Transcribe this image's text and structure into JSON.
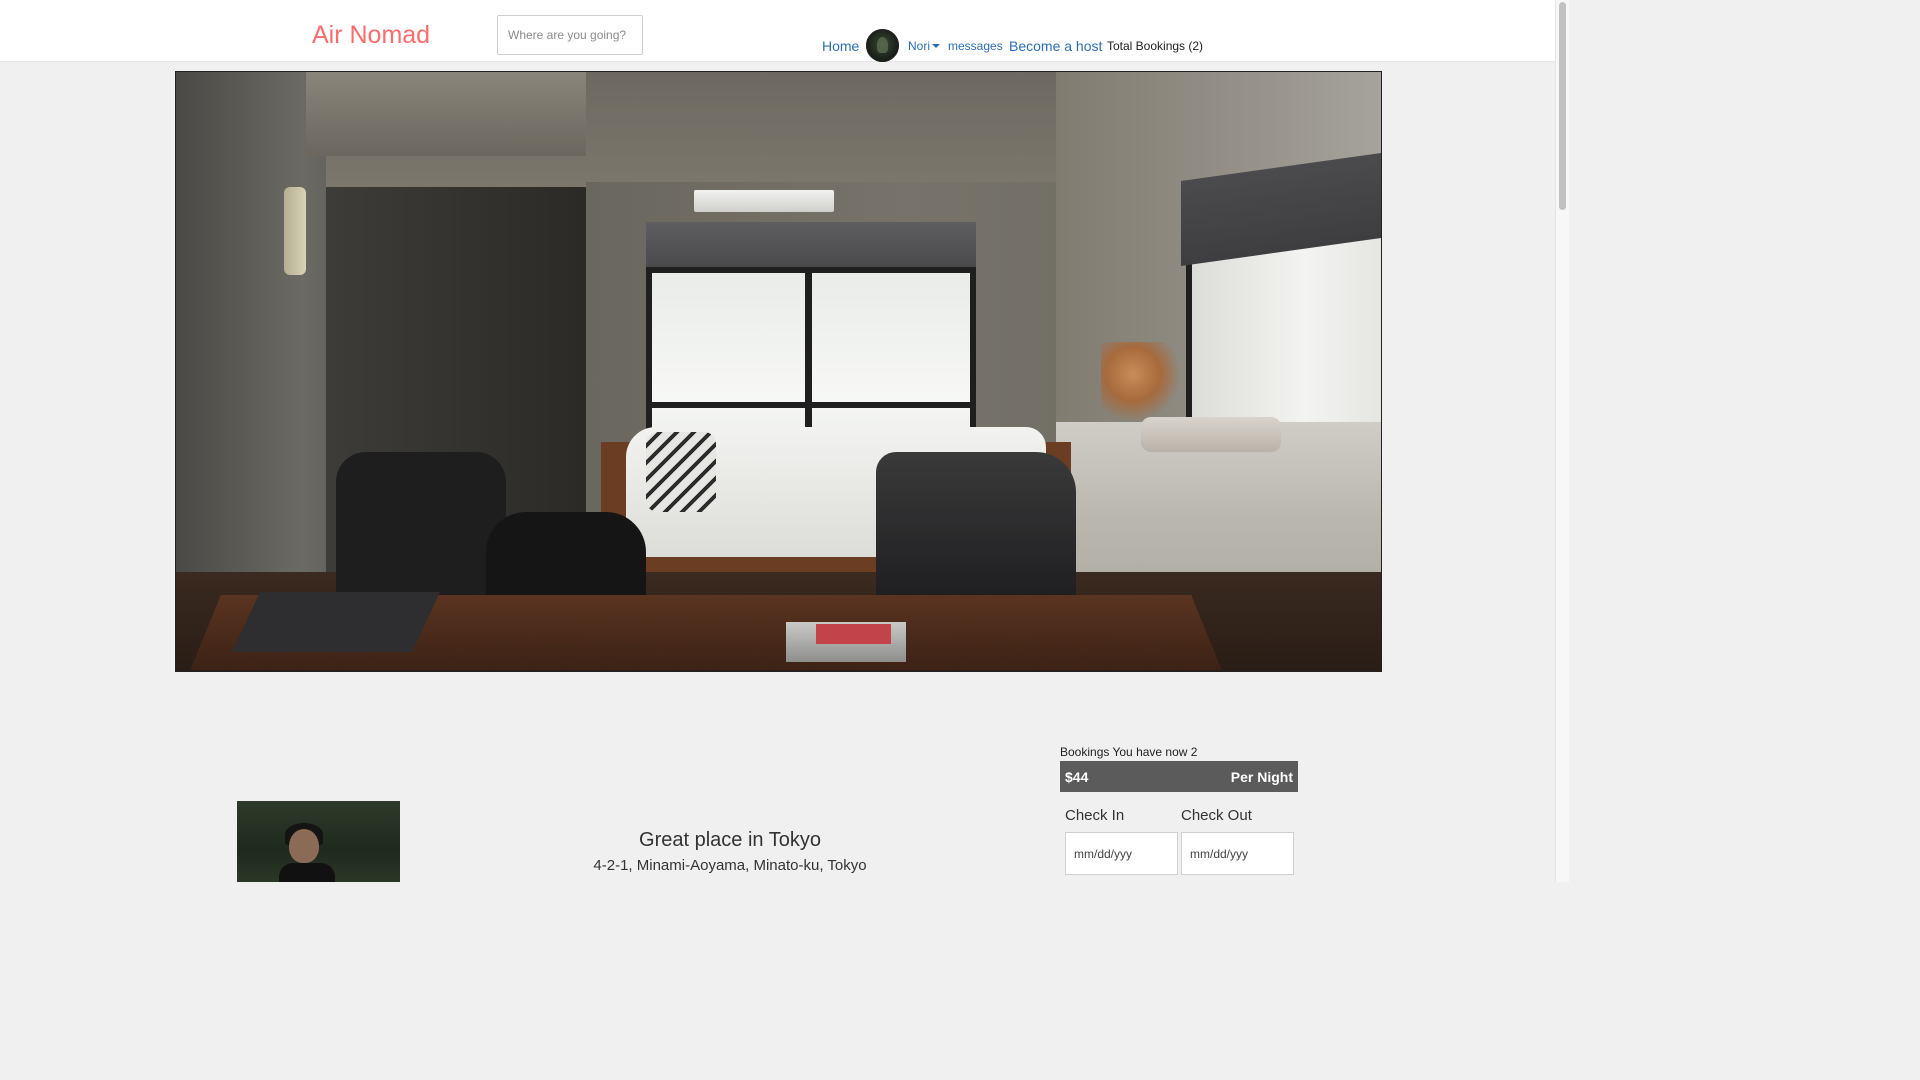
{
  "header": {
    "brand": "Air Nomad",
    "search_placeholder": "Where are you going?",
    "nav": {
      "home": "Home",
      "user_name": "Nori",
      "messages": "messages",
      "become_host": "Become a host",
      "total_bookings": "Total Bookings (2)"
    }
  },
  "booking": {
    "count_text": "Bookings You have now 2",
    "price": "$44",
    "price_unit": "Per Night",
    "check_in_label": "Check In",
    "check_out_label": "Check Out",
    "check_in_placeholder": "mm/dd/yyy",
    "check_out_placeholder": "mm/dd/yyy"
  },
  "listing": {
    "title": "Great place in Tokyo",
    "address": "4-2-1, Minami-Aoyama, Minato-ku, Tokyo"
  },
  "colors": {
    "brand": "#ff6b6b",
    "link": "#2a6ebb",
    "price_bar": "#5b5b5b",
    "page_bg": "#f0f0f0"
  },
  "icons": {
    "user_menu_caret": "caret-down-icon"
  }
}
